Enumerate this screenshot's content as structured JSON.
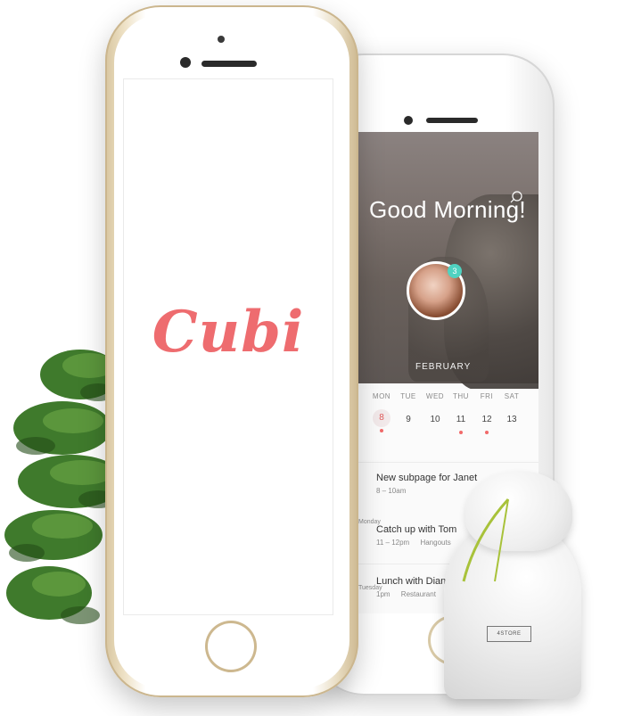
{
  "brand": {
    "logo_text": "Cubi",
    "logo_color": "#ee6c6f",
    "accent_teal": "#4fd2c0"
  },
  "app_screen": {
    "greeting": "Good Morning!",
    "notification_badge": "3",
    "month": "FEBRUARY",
    "search_icon": "search-icon"
  },
  "calendar": {
    "days": [
      {
        "name": "MON",
        "date": "8",
        "has_event": true,
        "selected": true
      },
      {
        "name": "TUE",
        "date": "9",
        "has_event": false,
        "selected": false
      },
      {
        "name": "WED",
        "date": "10",
        "has_event": false,
        "selected": false
      },
      {
        "name": "THU",
        "date": "11",
        "has_event": true,
        "selected": false
      },
      {
        "name": "FRI",
        "date": "12",
        "has_event": true,
        "selected": false
      },
      {
        "name": "SAT",
        "date": "13",
        "has_event": false,
        "selected": false
      }
    ]
  },
  "events": [
    {
      "title": "New subpage for Janet",
      "time": "8 – 10am",
      "place": ""
    },
    {
      "day": "Monday",
      "title": "Catch up with Tom",
      "time": "11 – 12pm",
      "place": "Hangouts"
    },
    {
      "day": "Tuesday",
      "title": "Lunch with Diane",
      "time": "1pm",
      "place": "Restaurant"
    }
  ],
  "bag": {
    "label": "4STORE"
  }
}
